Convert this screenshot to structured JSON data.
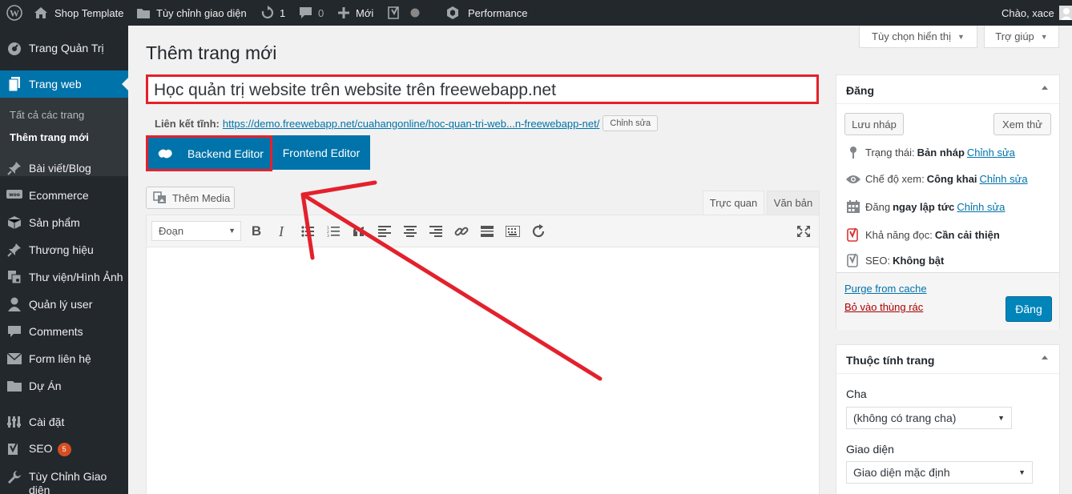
{
  "admin_bar": {
    "site_name": "Shop Template",
    "customize": "Tùy chỉnh giao diện",
    "updates_count": "1",
    "comments_count": "0",
    "new_label": "Mới",
    "performance": "Performance",
    "greeting": "Chào, xace"
  },
  "sidebar": {
    "items": [
      {
        "label": "Trang Quản Trị",
        "icon": "dashboard-icon"
      },
      {
        "label": "Trang web",
        "icon": "pages-icon"
      },
      {
        "label": "Bài viết/Blog",
        "icon": "pin-icon"
      },
      {
        "label": "Ecommerce",
        "icon": "woo-icon"
      },
      {
        "label": "Sản phẩm",
        "icon": "box-icon"
      },
      {
        "label": "Thương hiệu",
        "icon": "pin-icon"
      },
      {
        "label": "Thư viện/Hình Ảnh",
        "icon": "media-icon"
      },
      {
        "label": "Quản lý user",
        "icon": "user-icon"
      },
      {
        "label": "Comments",
        "icon": "comment-icon"
      },
      {
        "label": "Form liên hệ",
        "icon": "mail-icon"
      },
      {
        "label": "Dự Án",
        "icon": "folder-icon"
      },
      {
        "label": "Cài đặt",
        "icon": "settings-icon"
      },
      {
        "label": "SEO",
        "icon": "yoast-icon",
        "badge": "5"
      },
      {
        "label": "Tùy Chỉnh Giao diện",
        "icon": "wrench-icon"
      }
    ],
    "submenu": [
      {
        "label": "Tất cả các trang"
      },
      {
        "label": "Thêm trang mới"
      }
    ]
  },
  "screen_options": {
    "screen": "Tùy chọn hiển thị",
    "help": "Trợ giúp"
  },
  "page": {
    "heading": "Thêm trang mới",
    "title_value": "Học quản trị website trên website trên freewebapp.net",
    "permalink_label": "Liên kết tĩnh:",
    "permalink_base": "https://demo.freewebapp.net/cuahangonline/",
    "permalink_slug": "hoc-quan-tri-web...n-freewebapp-net",
    "permalink_tail": "/",
    "permalink_edit": "Chỉnh sửa",
    "backend_editor": "Backend Editor",
    "frontend_editor": "Frontend Editor",
    "add_media": "Thêm Media",
    "tab_visual": "Trực quan",
    "tab_text": "Văn bản",
    "format_value": "Đoạn"
  },
  "publish_box": {
    "title": "Đăng",
    "save_draft": "Lưu nháp",
    "preview": "Xem thử",
    "status_label": "Trạng thái:",
    "status_value": "Bản nháp",
    "visibility_label": "Chế độ xem:",
    "visibility_value": "Công khai",
    "schedule_label": "Đăng",
    "schedule_value": "ngay lập tức",
    "edit_link": "Chỉnh sửa",
    "readability_label": "Khả năng đọc:",
    "readability_value": "Cần cải thiện",
    "seo_label": "SEO:",
    "seo_value": "Không bật",
    "purge": "Purge from cache",
    "trash": "Bỏ vào thùng rác",
    "publish": "Đăng"
  },
  "attributes_box": {
    "title": "Thuộc tính trang",
    "parent_label": "Cha",
    "parent_value": "(không có trang cha)",
    "template_label": "Giao diện",
    "template_value": "Giao diện mặc định"
  },
  "colors": {
    "accent": "#0073aa",
    "annotation": "#e3212c",
    "admin_dark": "#23282d"
  }
}
